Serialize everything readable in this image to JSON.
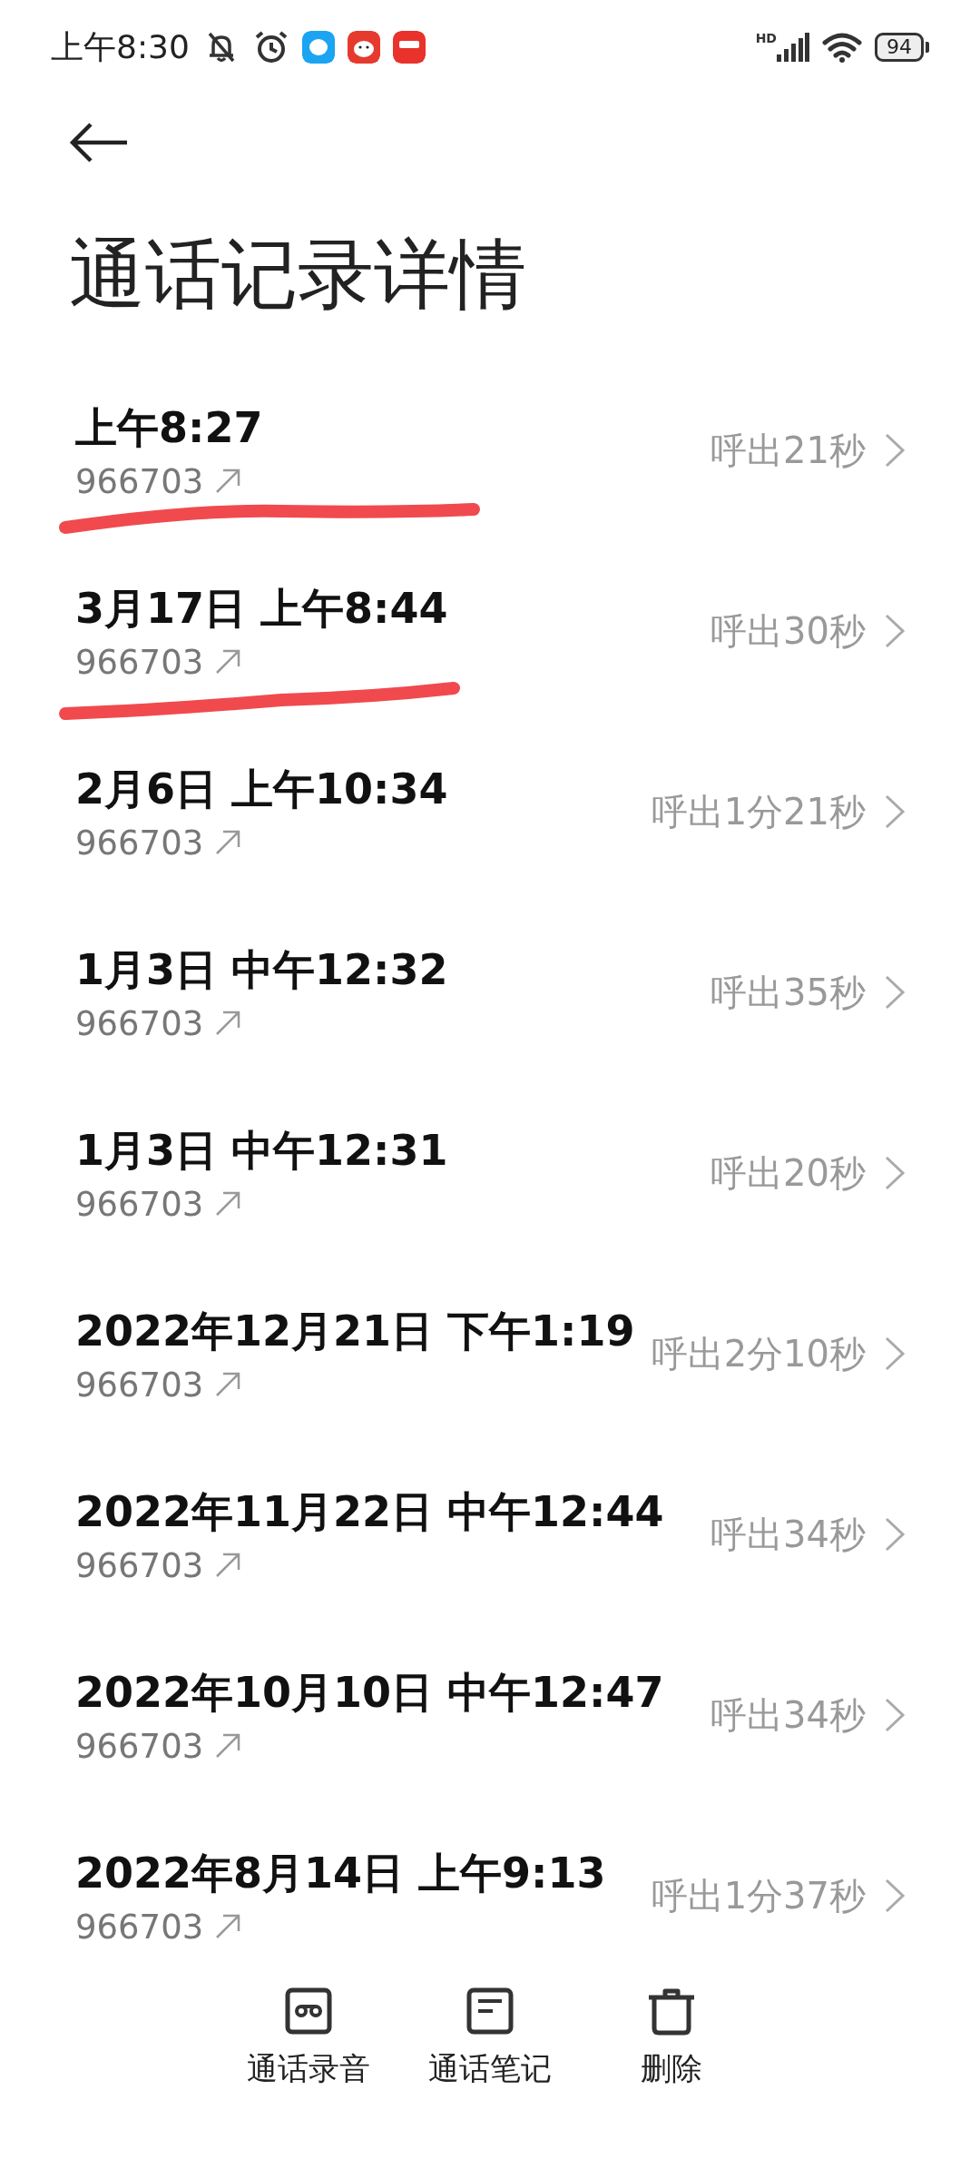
{
  "status_bar": {
    "time": "上午8:30",
    "network": "HD",
    "battery": "94"
  },
  "title": "通话记录详情",
  "calls": [
    {
      "time": "上午8:27",
      "number": "966703",
      "summary": "呼出21秒",
      "underlined": true
    },
    {
      "time": "3月17日 上午8:44",
      "number": "966703",
      "summary": "呼出30秒",
      "underlined": true
    },
    {
      "time": "2月6日 上午10:34",
      "number": "966703",
      "summary": "呼出1分21秒",
      "underlined": false
    },
    {
      "time": "1月3日 中午12:32",
      "number": "966703",
      "summary": "呼出35秒",
      "underlined": false
    },
    {
      "time": "1月3日 中午12:31",
      "number": "966703",
      "summary": "呼出20秒",
      "underlined": false
    },
    {
      "time": "2022年12月21日 下午1:19",
      "number": "966703",
      "summary": "呼出2分10秒",
      "underlined": false
    },
    {
      "time": "2022年11月22日 中午12:44",
      "number": "966703",
      "summary": "呼出34秒",
      "underlined": false
    },
    {
      "time": "2022年10月10日 中午12:47",
      "number": "966703",
      "summary": "呼出34秒",
      "underlined": false
    },
    {
      "time": "2022年8月14日 上午9:13",
      "number": "966703",
      "summary": "呼出1分37秒",
      "underlined": false
    }
  ],
  "actions": [
    {
      "kind": "recording",
      "label": "通话录音"
    },
    {
      "kind": "notes",
      "label": "通话笔记"
    },
    {
      "kind": "delete",
      "label": "删除"
    }
  ]
}
